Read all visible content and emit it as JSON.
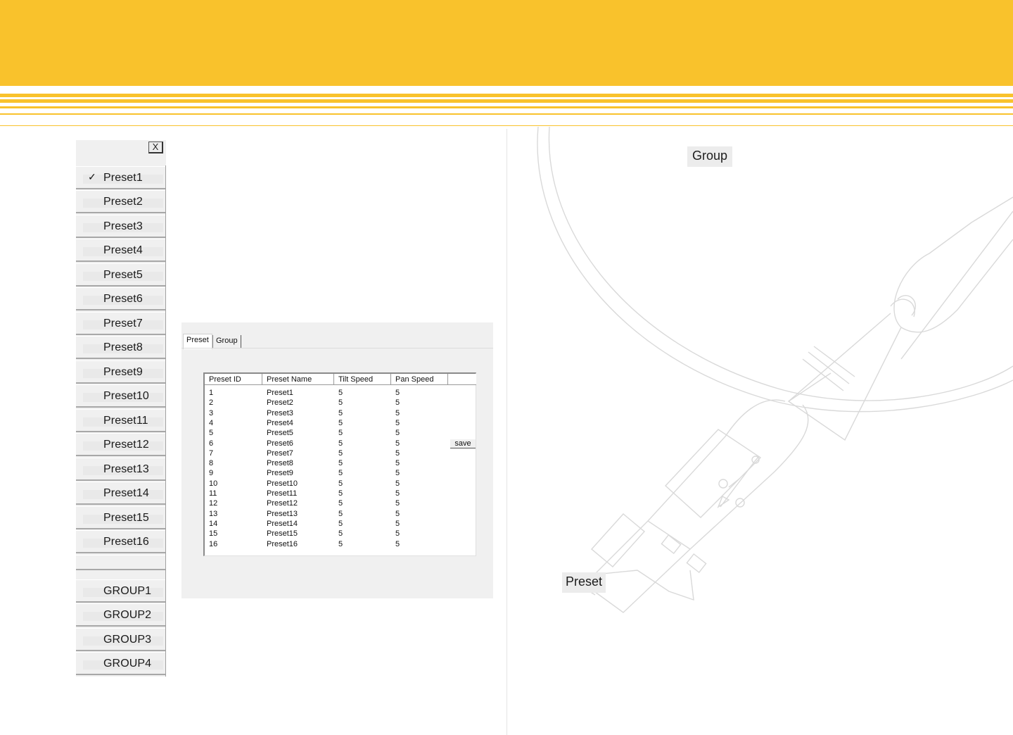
{
  "menu": {
    "close_label": "X",
    "items": [
      {
        "label": "Preset1",
        "checked": true
      },
      {
        "label": "Preset2",
        "checked": false
      },
      {
        "label": "Preset3",
        "checked": false
      },
      {
        "label": "Preset4",
        "checked": false
      },
      {
        "label": "Preset5",
        "checked": false
      },
      {
        "label": "Preset6",
        "checked": false
      },
      {
        "label": "Preset7",
        "checked": false
      },
      {
        "label": "Preset8",
        "checked": false
      },
      {
        "label": "Preset9",
        "checked": false
      },
      {
        "label": "Preset10",
        "checked": false
      },
      {
        "label": "Preset11",
        "checked": false
      },
      {
        "label": "Preset12",
        "checked": false
      },
      {
        "label": "Preset13",
        "checked": false
      },
      {
        "label": "Preset14",
        "checked": false
      },
      {
        "label": "Preset15",
        "checked": false
      },
      {
        "label": "Preset16",
        "checked": false
      }
    ],
    "groups": [
      "GROUP1",
      "GROUP2",
      "GROUP3",
      "GROUP4"
    ],
    "check_glyph": "✓"
  },
  "panel": {
    "tabs": [
      "Preset",
      "Group"
    ],
    "columns": [
      "Preset ID",
      "Preset Name",
      "Tilt Speed",
      "Pan Speed"
    ],
    "rows": [
      [
        "1",
        "Preset1",
        "5",
        "5"
      ],
      [
        "2",
        "Preset2",
        "5",
        "5"
      ],
      [
        "3",
        "Preset3",
        "5",
        "5"
      ],
      [
        "4",
        "Preset4",
        "5",
        "5"
      ],
      [
        "5",
        "Preset5",
        "5",
        "5"
      ],
      [
        "6",
        "Preset6",
        "5",
        "5"
      ],
      [
        "7",
        "Preset7",
        "5",
        "5"
      ],
      [
        "8",
        "Preset8",
        "5",
        "5"
      ],
      [
        "9",
        "Preset9",
        "5",
        "5"
      ],
      [
        "10",
        "Preset10",
        "5",
        "5"
      ],
      [
        "11",
        "Preset11",
        "5",
        "5"
      ],
      [
        "12",
        "Preset12",
        "5",
        "5"
      ],
      [
        "13",
        "Preset13",
        "5",
        "5"
      ],
      [
        "14",
        "Preset14",
        "5",
        "5"
      ],
      [
        "15",
        "Preset15",
        "5",
        "5"
      ],
      [
        "16",
        "Preset16",
        "5",
        "5"
      ]
    ],
    "save_label": "save"
  },
  "right": {
    "group_button": "Group",
    "preset_button": "Preset"
  },
  "colors": {
    "header": "#f9c22c",
    "menu_bg": "#f0f0f0",
    "usb_outline": "#d9d9d9"
  },
  "icons": {
    "background": "usb-cable-illustration",
    "usb_symbol": "usb-icon"
  }
}
